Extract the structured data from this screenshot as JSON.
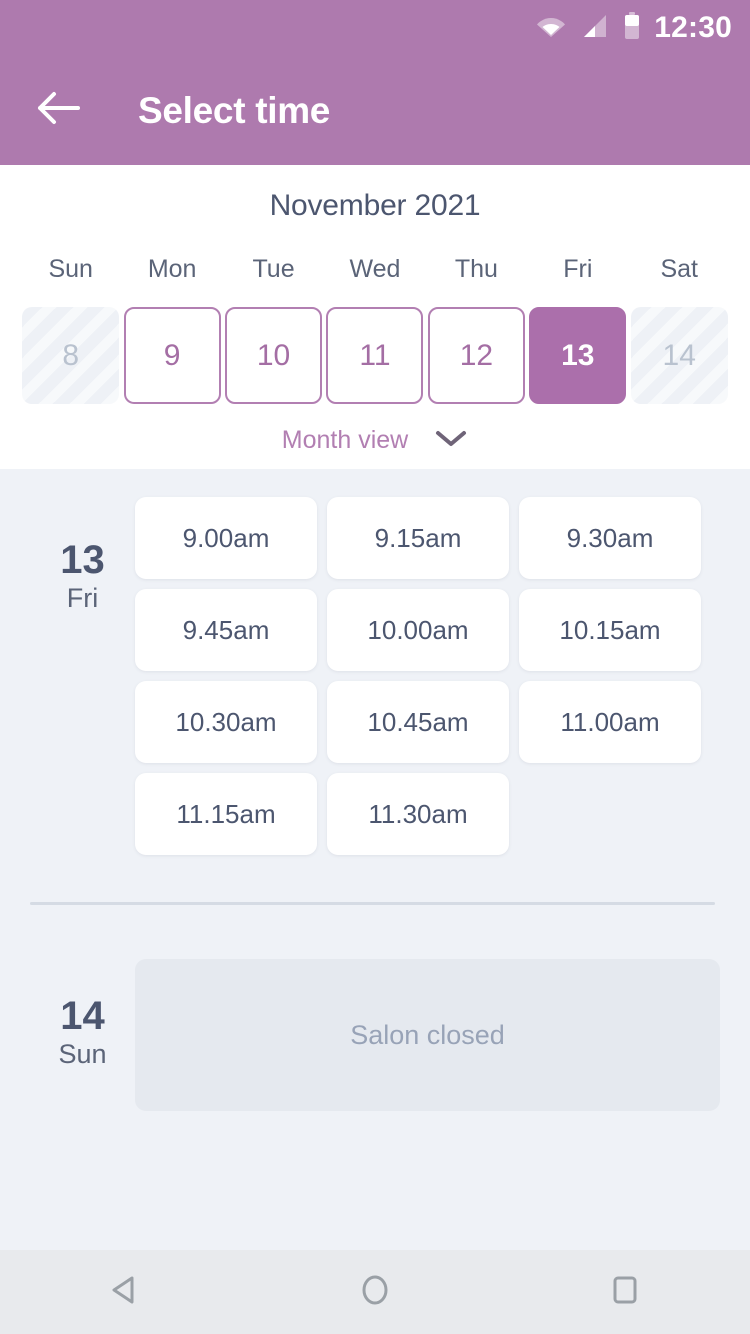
{
  "statusbar": {
    "time": "12:30",
    "icons": [
      "wifi-icon",
      "signal-icon",
      "battery-icon"
    ]
  },
  "appbar": {
    "back_icon": "back-arrow-icon",
    "title": "Select time"
  },
  "calendar": {
    "month_title": "November 2021",
    "weekday_headers": [
      "Sun",
      "Mon",
      "Tue",
      "Wed",
      "Thu",
      "Fri",
      "Sat"
    ],
    "days": [
      {
        "number": "8",
        "state": "disabled"
      },
      {
        "number": "9",
        "state": "available"
      },
      {
        "number": "10",
        "state": "available"
      },
      {
        "number": "11",
        "state": "available"
      },
      {
        "number": "12",
        "state": "available"
      },
      {
        "number": "13",
        "state": "selected"
      },
      {
        "number": "14",
        "state": "disabled"
      }
    ],
    "month_view_label": "Month view",
    "month_view_icon": "chevron-down-icon"
  },
  "schedule": [
    {
      "date_number": "13",
      "weekday": "Fri",
      "slots": [
        "9.00am",
        "9.15am",
        "9.30am",
        "9.45am",
        "10.00am",
        "10.15am",
        "10.30am",
        "10.45am",
        "11.00am",
        "11.15am",
        "11.30am"
      ],
      "closed_message": null
    },
    {
      "date_number": "14",
      "weekday": "Sun",
      "slots": [],
      "closed_message": "Salon closed"
    }
  ],
  "navbar": {
    "back_label": "back-nav-icon",
    "home_label": "home-nav-icon",
    "recents_label": "recents-nav-icon"
  },
  "colors": {
    "brand_purple": "#ae7aae",
    "selected_day": "#ab6fab",
    "day_outline": "#b27fb2",
    "text_dark": "#4c566f",
    "page_bg": "#eff2f7",
    "closed_bg": "#e5e9ef"
  }
}
